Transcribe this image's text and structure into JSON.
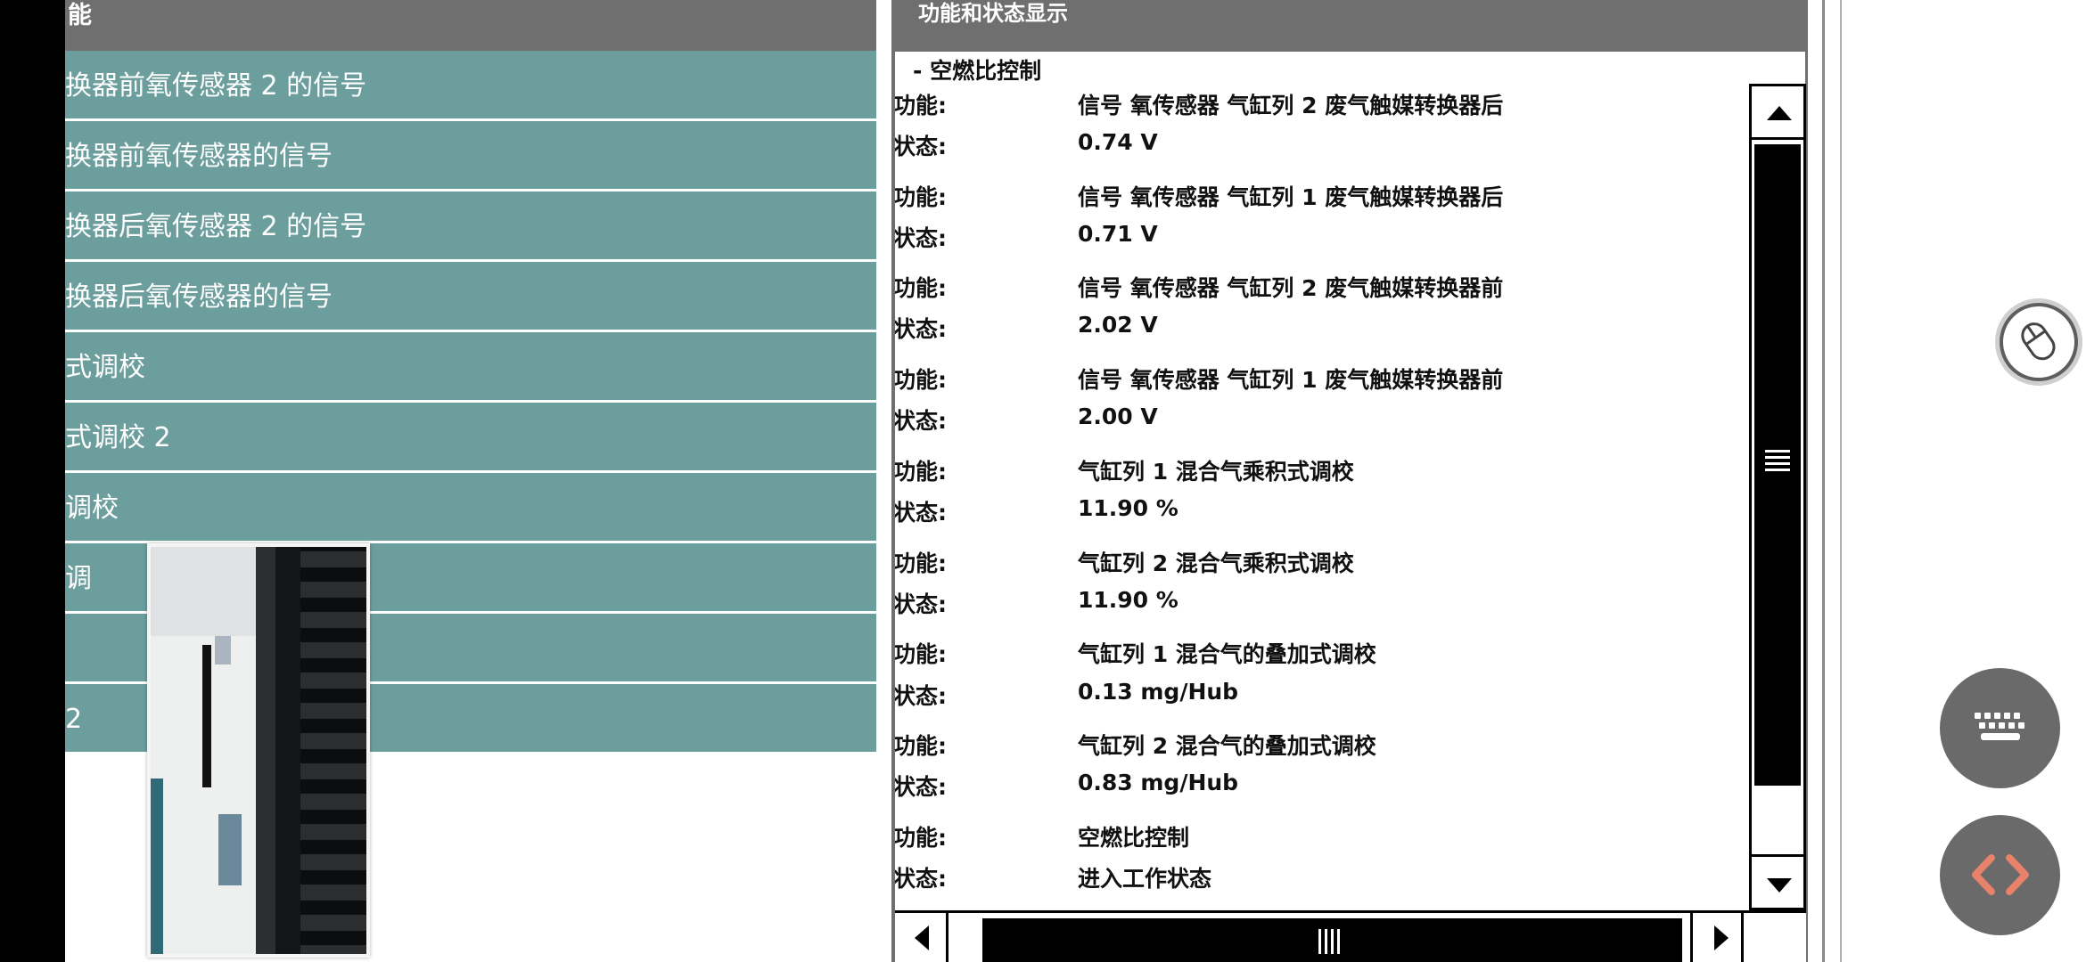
{
  "left_panel": {
    "header_title": "能",
    "items": [
      {
        "label": "换器前氧传感器 2 的信号"
      },
      {
        "label": "换器前氧传感器的信号"
      },
      {
        "label": "换器后氧传感器 2 的信号"
      },
      {
        "label": "换器后氧传感器的信号"
      },
      {
        "label": "式调校"
      },
      {
        "label": "式调校 2"
      },
      {
        "label": "调校"
      },
      {
        "label": "调"
      },
      {
        "label": ""
      },
      {
        "label": "2"
      }
    ]
  },
  "right_panel": {
    "header_title": "功能和状态显示",
    "group_title": "- 空燃比控制",
    "rows": [
      {
        "label": "功能:",
        "value": "信号 氧传感器 气缸列 2 废气触媒转换器后"
      },
      {
        "label": "状态:",
        "value": "0.74 V"
      },
      {
        "label": "功能:",
        "value": "信号 氧传感器 气缸列 1 废气触媒转换器后"
      },
      {
        "label": "状态:",
        "value": "0.71 V"
      },
      {
        "label": "功能:",
        "value": "信号 氧传感器 气缸列 2 废气触媒转换器前"
      },
      {
        "label": "状态:",
        "value": "2.02 V"
      },
      {
        "label": "功能:",
        "value": "信号 氧传感器 气缸列 1 废气触媒转换器前"
      },
      {
        "label": "状态:",
        "value": "2.00 V"
      },
      {
        "label": "功能:",
        "value": "气缸列 1 混合气乘积式调校"
      },
      {
        "label": "状态:",
        "value": "11.90 %"
      },
      {
        "label": "功能:",
        "value": "气缸列 2 混合气乘积式调校"
      },
      {
        "label": "状态:",
        "value": "11.90 %"
      },
      {
        "label": "功能:",
        "value": "气缸列 1 混合气的叠加式调校"
      },
      {
        "label": "状态:",
        "value": "0.13 mg/Hub"
      },
      {
        "label": "功能:",
        "value": "气缸列 2 混合气的叠加式调校"
      },
      {
        "label": "状态:",
        "value": "0.83 mg/Hub"
      },
      {
        "label": "功能:",
        "value": "空燃比控制"
      },
      {
        "label": "状态:",
        "value": "进入工作状态"
      }
    ]
  },
  "overlay": {
    "mouse_icon": "mouse-icon",
    "keyboard_icon": "keyboard-icon",
    "code_icon": "code-icon"
  },
  "colors": {
    "header_gray": "#6f6f6f",
    "list_teal": "#6b9e9d",
    "code_accent": "#e8826a"
  }
}
